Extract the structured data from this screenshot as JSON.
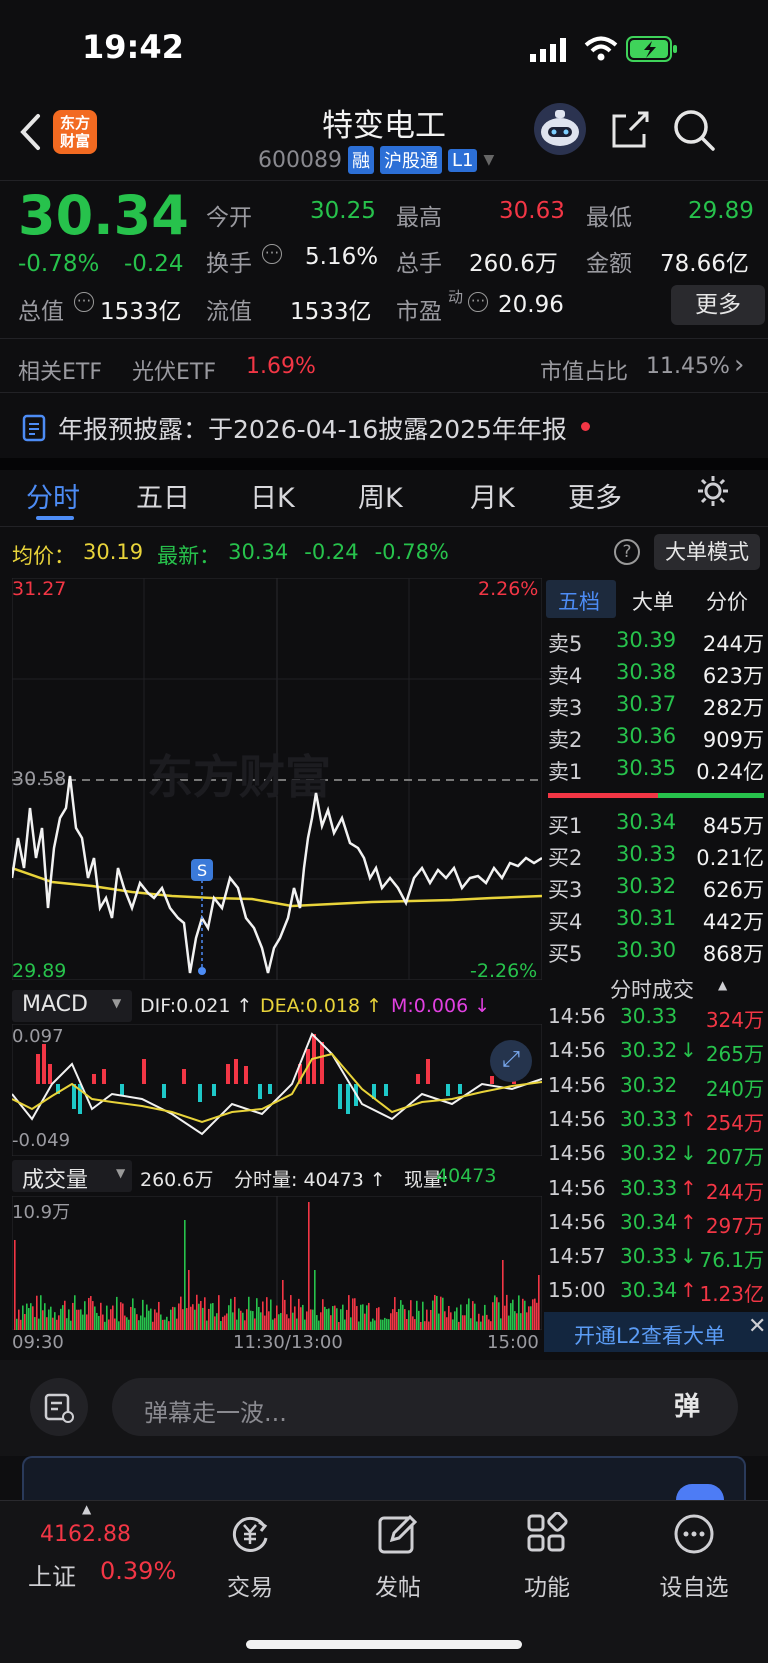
{
  "status": {
    "time": "19:42"
  },
  "header": {
    "title": "特变电工",
    "code": "600089",
    "tags": [
      "融",
      "沪股通",
      "L1"
    ],
    "logo_text_1": "东方",
    "logo_text_2": "财富"
  },
  "quote": {
    "price": "30.34",
    "change_pct": "-0.78%",
    "change": "-0.24",
    "open_label": "今开",
    "open": "30.25",
    "high_label": "最高",
    "high": "30.63",
    "low_label": "最低",
    "low": "29.89",
    "turnover_label": "换手",
    "turnover": "5.16%",
    "volume_label": "总手",
    "volume": "260.6万",
    "amount_label": "金额",
    "amount": "78.66亿",
    "mktcap_label": "总值",
    "mktcap": "1533亿",
    "float_label": "流值",
    "float": "1533亿",
    "pe_label": "市盈",
    "pe_sup": "动",
    "pe": "20.96",
    "more_label": "更多"
  },
  "etf": {
    "label": "相关ETF",
    "name": "光伏ETF",
    "pct": "1.69%",
    "share_label": "市值占比",
    "share": "11.45%"
  },
  "notice": {
    "text": "年报预披露：于2026-04-16披露2025年年报"
  },
  "tabs": [
    "分时",
    "五日",
    "日K",
    "周K",
    "月K",
    "更多"
  ],
  "avg_bar": {
    "avg_label": "均价：",
    "avg": "30.19",
    "latest_label": "最新：",
    "latest": "30.34",
    "chg": "-0.24",
    "pct": "-0.78%",
    "bigorder_label": "大单模式"
  },
  "chart_axis": {
    "top_price": "31.27",
    "top_pct": "2.26%",
    "mid_price": "30.58",
    "bot_price": "29.89",
    "bot_pct": "-2.26%",
    "watermark": "东方财富",
    "s_marker": "S"
  },
  "macd": {
    "label": "MACD",
    "dif": "DIF:0.021 ↑",
    "dea": "DEA:0.018 ↑",
    "m": "M:0.006 ↓",
    "top": "0.097",
    "bottom": "-0.049"
  },
  "volume_panel": {
    "label": "成交量",
    "total": "260.6万",
    "fenshi": "分时量: 40473 ↑",
    "xianliang_label": "现量:",
    "xianliang": "40473",
    "max": "10.9万",
    "t_start": "09:30",
    "t_mid": "11:30/13:00",
    "t_end": "15:00"
  },
  "orderbook": {
    "tabs": [
      "五档",
      "大单",
      "分价"
    ],
    "asks": [
      {
        "label": "卖5",
        "price": "30.39",
        "vol": "244万"
      },
      {
        "label": "卖4",
        "price": "30.38",
        "vol": "623万"
      },
      {
        "label": "卖3",
        "price": "30.37",
        "vol": "282万"
      },
      {
        "label": "卖2",
        "price": "30.36",
        "vol": "909万"
      },
      {
        "label": "卖1",
        "price": "30.35",
        "vol": "0.24亿"
      }
    ],
    "bids": [
      {
        "label": "买1",
        "price": "30.34",
        "vol": "845万"
      },
      {
        "label": "买2",
        "price": "30.33",
        "vol": "0.21亿"
      },
      {
        "label": "买3",
        "price": "30.32",
        "vol": "626万"
      },
      {
        "label": "买4",
        "price": "30.31",
        "vol": "442万"
      },
      {
        "label": "买5",
        "price": "30.30",
        "vol": "868万"
      }
    ],
    "trades_title": "分时成交",
    "trades": [
      {
        "t": "14:56",
        "p": "30.33",
        "arrow": "",
        "v": "324万",
        "vc": "red"
      },
      {
        "t": "14:56",
        "p": "30.32",
        "arrow": "↓",
        "v": "265万",
        "vc": "green"
      },
      {
        "t": "14:56",
        "p": "30.32",
        "arrow": "",
        "v": "240万",
        "vc": "green"
      },
      {
        "t": "14:56",
        "p": "30.33",
        "arrow": "↑",
        "v": "254万",
        "vc": "red"
      },
      {
        "t": "14:56",
        "p": "30.32",
        "arrow": "↓",
        "v": "207万",
        "vc": "green"
      },
      {
        "t": "14:56",
        "p": "30.33",
        "arrow": "↑",
        "v": "244万",
        "vc": "red"
      },
      {
        "t": "14:56",
        "p": "30.34",
        "arrow": "↑",
        "v": "297万",
        "vc": "red"
      },
      {
        "t": "14:57",
        "p": "30.33",
        "arrow": "↓",
        "v": "76.1万",
        "vc": "green"
      },
      {
        "t": "15:00",
        "p": "30.34",
        "arrow": "↑",
        "v": "1.23亿",
        "vc": "red"
      }
    ],
    "l2_banner": "开通L2查看大单"
  },
  "comment": {
    "placeholder": "弹幕走一波...",
    "dan_label": "弹"
  },
  "bottom_nav": {
    "index_value": "4162.88",
    "index_name": "上证",
    "index_pct": "0.39%",
    "items": [
      "交易",
      "发帖",
      "功能",
      "设自选"
    ]
  },
  "colors": {
    "up": "#f23645",
    "down": "#27c24c",
    "avg_line": "#e8d33a",
    "accent": "#2c6fd6"
  }
}
